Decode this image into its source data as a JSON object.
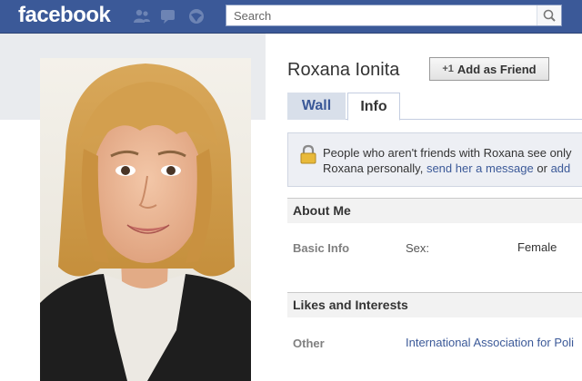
{
  "topbar": {
    "logo": "facebook",
    "search_placeholder": "Search",
    "icons": [
      "friends-icon",
      "messages-icon",
      "notifications-icon",
      "search-icon"
    ],
    "colors": {
      "bar": "#3b5998"
    }
  },
  "profile": {
    "name": "Roxana Ionita",
    "add_friend_icon": "+1",
    "add_friend_label": "Add as Friend"
  },
  "tabs": [
    {
      "label": "Wall"
    },
    {
      "label": "Info",
      "active": true
    }
  ],
  "notice": {
    "line1": "People who aren't friends with Roxana see only",
    "line2_prefix": "Roxana personally,",
    "link1": "send her a message",
    "line2_mid": "or",
    "link2": "add"
  },
  "about": {
    "title": "About Me",
    "basic_info_label": "Basic Info",
    "sex_label": "Sex:",
    "sex_value": "Female"
  },
  "likes": {
    "title": "Likes and Interests",
    "other_label": "Other",
    "other_value": "International Association for Poli"
  }
}
